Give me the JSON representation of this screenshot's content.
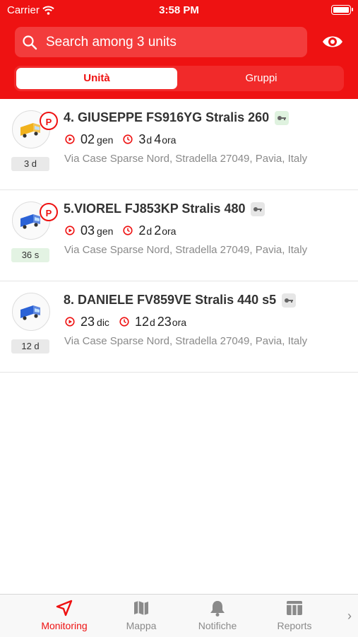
{
  "status_bar": {
    "carrier": "Carrier",
    "time": "3:58 PM"
  },
  "search": {
    "placeholder": "Search among 3 units"
  },
  "segments": {
    "active": "Unità",
    "inactive": "Gruppi"
  },
  "units": [
    {
      "parking_badge": "P",
      "age": "3 d",
      "age_color": "#e9e9e9",
      "name": "4. GIUSEPPE FS916YG Stralis 260",
      "truck_color": "#f1b21d",
      "key_color": "#dff2df",
      "start_num": "02",
      "start_unit": "gen",
      "d_num": "3",
      "d_unit": "d",
      "h_num": "4",
      "h_unit": "ora",
      "address": "Via Case Sparse Nord, Stradella 27049, Pavia, Italy"
    },
    {
      "parking_badge": "P",
      "age": "36 s",
      "age_color": "#e3f3e3",
      "name": "5.VIOREL FJ853KP Stralis 480",
      "truck_color": "#2b62d6",
      "key_color": "#e6e6e6",
      "start_num": "03",
      "start_unit": "gen",
      "d_num": "2",
      "d_unit": "d",
      "h_num": "2",
      "h_unit": "ora",
      "address": "Via Case Sparse Nord, Stradella 27049, Pavia, Italy"
    },
    {
      "parking_badge": "",
      "age": "12 d",
      "age_color": "#e9e9e9",
      "name": "8. DANIELE FV859VE Stralis 440 s5",
      "truck_color": "#2b62d6",
      "key_color": "#e6e6e6",
      "start_num": "23",
      "start_unit": "dic",
      "d_num": "12",
      "d_unit": "d",
      "h_num": "23",
      "h_unit": "ora",
      "address": "Via Case Sparse Nord, Stradella 27049, Pavia, Italy"
    }
  ],
  "tabbar": {
    "monitoring": "Monitoring",
    "mappa": "Mappa",
    "notifiche": "Notifiche",
    "reports": "Reports",
    "more": "›"
  },
  "colors": {
    "brand": "#ee1212",
    "accent": "#e11111"
  }
}
